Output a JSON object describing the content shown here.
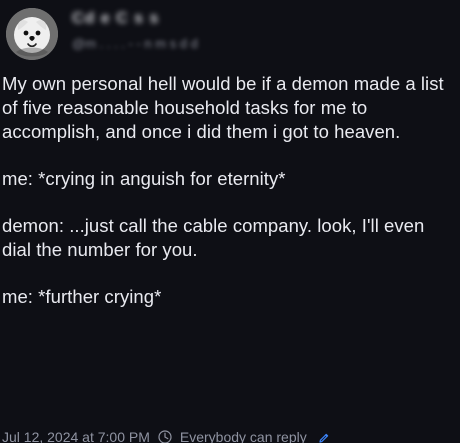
{
  "header": {
    "display_name": "Cd e C s s",
    "handle": "@m . . . . - - n m s d d"
  },
  "body": {
    "paragraphs": [
      "My own personal hell would be if a demon made a list of five reasonable household tasks for me to accomplish, and once i did them i got to heaven.",
      "me: *crying in anguish for eternity*",
      "demon: ...just call the cable company. look, I'll even dial the number for you.",
      "me: *further crying*"
    ]
  },
  "footer": {
    "timestamp": "Jul 12, 2024 at 7:00 PM",
    "reply_setting": "Everybody can reply"
  },
  "icons": {
    "avatar": "dog-avatar-icon",
    "reply": "reply-scope-icon",
    "edit": "pencil-icon"
  },
  "colors": {
    "background": "#0e0f15",
    "text": "#e9eaf0",
    "muted": "#8f93a1",
    "link": "#3b82f6"
  }
}
